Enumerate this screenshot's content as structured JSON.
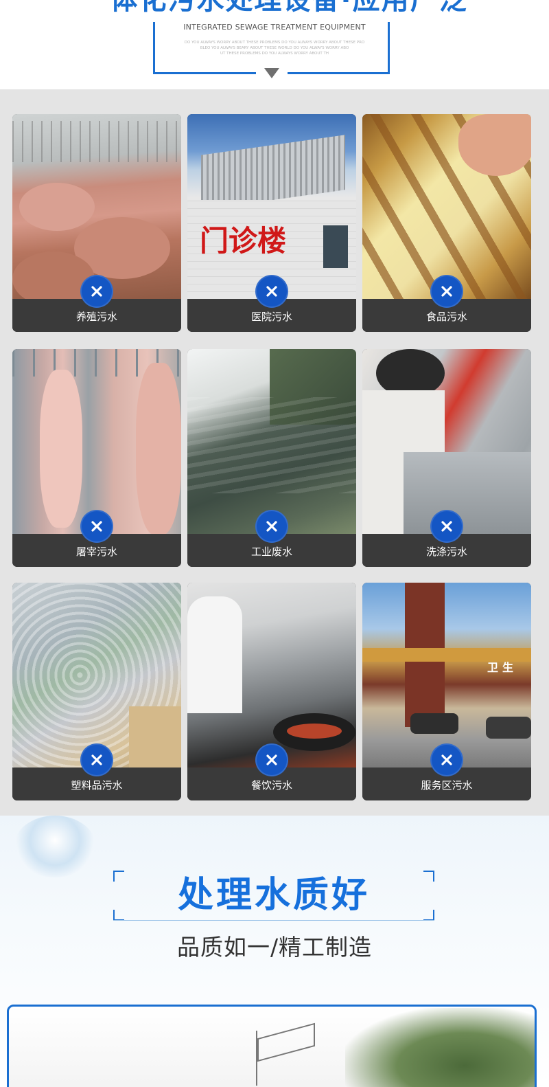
{
  "header": {
    "title": "一体化污水处理设备·应用广泛",
    "subtitle_en": "INTEGRATED SEWAGE TREATMENT EQUIPMENT",
    "small_lines": [
      "DO YOU ALWAYS WORRY ABOUT THESE PROBLEMS DO YOU ALWAYS WORRY ABOUT THESE PRO",
      "BLEO YOU ALWAYS BEARY ABOUT THESE WORLD DO YOU ALWAYS WORRY ABO",
      "UT THESE PROBLEMS DO YOU ALWAYS WORRY ABOUT TH"
    ]
  },
  "applications": [
    {
      "label": "养殖污水"
    },
    {
      "label": "医院污水"
    },
    {
      "label": "食品污水"
    },
    {
      "label": "屠宰污水"
    },
    {
      "label": "工业废水"
    },
    {
      "label": "洗涤污水"
    },
    {
      "label": "塑料品污水"
    },
    {
      "label": "餐饮污水"
    },
    {
      "label": "服务区污水"
    }
  ],
  "photo_text": {
    "hospital_sign": "门诊楼",
    "service_sign": "卫生"
  },
  "quality": {
    "title": "处理水质好",
    "subtitle": "品质如一/精工制造"
  },
  "icons": {
    "close": "close-icon",
    "arrow": "triangle-down-icon"
  },
  "colors": {
    "accent": "#1a6fd1",
    "button": "#1456c4",
    "label_bar": "#3a3a3a",
    "grid_bg": "#e4e4e4"
  }
}
